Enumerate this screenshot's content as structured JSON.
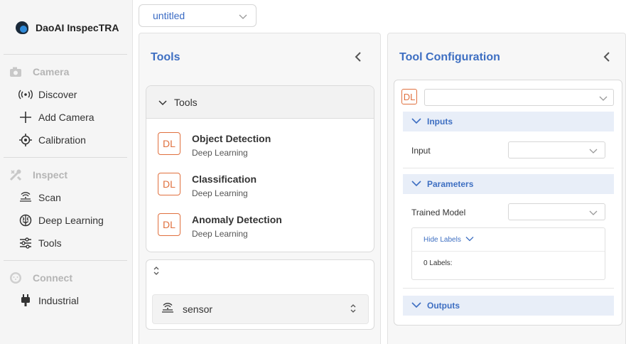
{
  "sidebar": {
    "brand": "DaoAI InspecTRA",
    "sections": [
      {
        "label": "Camera",
        "icon": "camera-icon"
      },
      {
        "label": "Inspect",
        "icon": "tools-icon"
      },
      {
        "label": "Connect",
        "icon": "connect-icon"
      }
    ],
    "items": [
      {
        "label": "Discover",
        "icon": "broadcast-icon"
      },
      {
        "label": "Add Camera",
        "icon": "plus-icon"
      },
      {
        "label": "Calibration",
        "icon": "crosshair-icon"
      },
      {
        "label": "Scan",
        "icon": "scan-icon"
      },
      {
        "label": "Deep Learning",
        "icon": "brain-icon"
      },
      {
        "label": "Tools",
        "icon": "sliders-icon"
      },
      {
        "label": "Industrial",
        "icon": "plug-icon"
      }
    ]
  },
  "project": {
    "selected": "untitled"
  },
  "tools_panel": {
    "title": "Tools",
    "group_label": "Tools",
    "items": [
      {
        "badge": "DL",
        "name": "Object Detection",
        "category": "Deep Learning"
      },
      {
        "badge": "DL",
        "name": "Classification",
        "category": "Deep Learning"
      },
      {
        "badge": "DL",
        "name": "Anomaly Detection",
        "category": "Deep Learning"
      }
    ],
    "sensor": {
      "label": "sensor"
    }
  },
  "config_panel": {
    "title": "Tool Configuration",
    "badge": "DL",
    "inputs_label": "Inputs",
    "input_label": "Input",
    "parameters_label": "Parameters",
    "trained_model_label": "Trained Model",
    "hide_labels": "Hide Labels",
    "labels_count": "0 Labels:",
    "outputs_label": "Outputs"
  },
  "colors": {
    "accent": "#3e6fc2",
    "badge": "#e0703e"
  }
}
